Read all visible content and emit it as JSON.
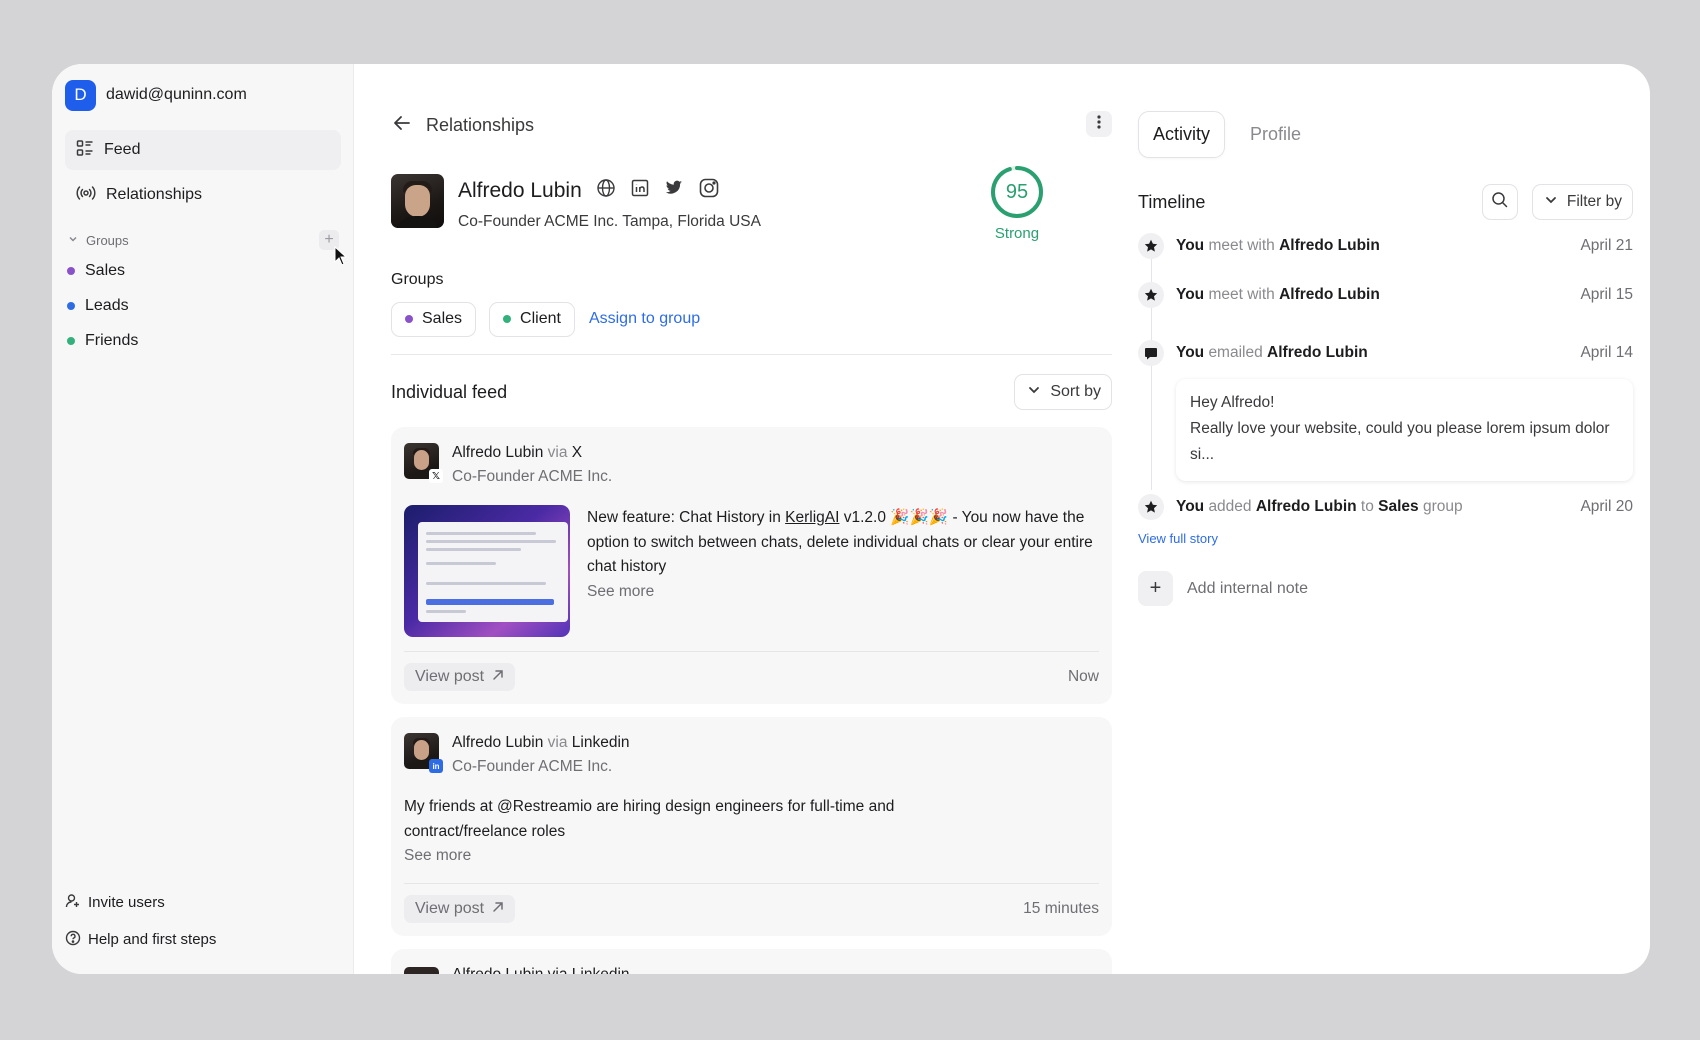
{
  "account": {
    "initial": "D",
    "email": "dawid@quninn.com",
    "color": "#1f5eea"
  },
  "nav": [
    {
      "label": "Feed",
      "icon": "feed-icon",
      "active": true
    },
    {
      "label": "Relationships",
      "icon": "broadcast-icon",
      "active": false
    }
  ],
  "groups_section": {
    "label": "Groups",
    "add": "+"
  },
  "groups": [
    {
      "label": "Sales",
      "color": "#8a52c9"
    },
    {
      "label": "Leads",
      "color": "#2e6ce6"
    },
    {
      "label": "Friends",
      "color": "#33b07c"
    }
  ],
  "bottom_links": [
    {
      "label": "Invite users",
      "icon": "user-plus-icon"
    },
    {
      "label": "Help and first steps",
      "icon": "help-icon"
    }
  ],
  "main": {
    "breadcrumb": "Relationships",
    "contact": {
      "name": "Alfredo Lubin",
      "subtitle": "Co-Founder ACME Inc. Tampa, Florida USA",
      "socials": [
        "globe-icon",
        "linkedin-icon",
        "twitter-icon",
        "instagram-icon"
      ]
    },
    "score": {
      "value": "95",
      "label": "Strong",
      "fraction": 0.95,
      "color": "#2aa070"
    },
    "groups_title": "Groups",
    "group_chips": [
      {
        "label": "Sales",
        "color": "#8a52c9"
      },
      {
        "label": "Client",
        "color": "#33b07c"
      }
    ],
    "assign_label": "Assign to group",
    "feed_title": "Individual feed",
    "sort_label": "Sort by",
    "posts": [
      {
        "author": "Alfredo Lubin",
        "via": "via",
        "source": "X",
        "role": "Co-Founder ACME Inc.",
        "text_pre": "New feature: Chat History in ",
        "text_link": "KerligAI",
        "text_post": " v1.2.0 🎉🎉🎉 - You now have the option to switch between chats, delete individual chats or clear your entire chat history",
        "see_more": "See more",
        "view_post": "View post",
        "time": "Now"
      },
      {
        "author": "Alfredo Lubin",
        "via": "via",
        "source": "Linkedin",
        "role": "Co-Founder ACME Inc.",
        "text": "My friends at @Restreamio are hiring design engineers for full-time and contract/freelance roles",
        "see_more": "See more",
        "view_post": "View post",
        "time": "15 minutes"
      }
    ],
    "peek_text": "Alfredo Lubin via Linkedin"
  },
  "right": {
    "tabs": [
      "Activity",
      "Profile"
    ],
    "timeline_title": "Timeline",
    "filter_label": "Filter by",
    "events": [
      {
        "icon": "star-icon",
        "you": "You",
        "verb": "meet with",
        "target": "Alfredo Lubin",
        "date": "April 21"
      },
      {
        "icon": "star-icon",
        "you": "You",
        "verb": "meet with",
        "target": "Alfredo Lubin",
        "date": "April 15"
      },
      {
        "icon": "message-icon",
        "you": "You",
        "verb": "emailed",
        "target": "Alfredo Lubin",
        "date": "April 14"
      },
      {
        "icon": "star-icon",
        "you": "You",
        "verb": "added",
        "target": "Alfredo Lubin",
        "verb2": "to",
        "target2": "Sales",
        "tail": "group",
        "date": "April 20"
      }
    ],
    "email": {
      "greeting": "Hey Alfredo!",
      "body": "Really love your website, could you please lorem ipsum dolor si..."
    },
    "view_full_story": "View full story",
    "add_note": "Add internal note"
  }
}
